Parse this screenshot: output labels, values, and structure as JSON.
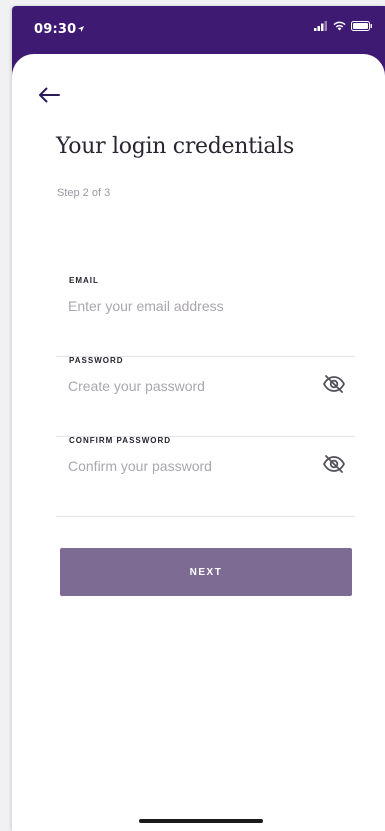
{
  "status_bar": {
    "time": "09:30",
    "icons": [
      "location-arrow-icon",
      "signal-icon",
      "wifi-icon",
      "battery-icon"
    ]
  },
  "header": {
    "back_icon": "arrow-left-icon",
    "title": "Your login credentials",
    "step": "Step 2 of 3"
  },
  "form": {
    "email": {
      "label": "EMAIL",
      "value": "",
      "placeholder": "Enter your email address"
    },
    "password": {
      "label": "PASSWORD",
      "value": "",
      "placeholder": "Create your password",
      "toggle_icon": "eye-slash-icon"
    },
    "confirm_password": {
      "label": "CONFIRM PASSWORD",
      "value": "",
      "placeholder": "Confirm your password",
      "toggle_icon": "eye-slash-icon"
    }
  },
  "actions": {
    "next_label": "NEXT"
  },
  "colors": {
    "brand_purple": "#3f1a73",
    "button": "#7d6b93",
    "text": "#2a2531",
    "muted": "#9a98a0"
  }
}
